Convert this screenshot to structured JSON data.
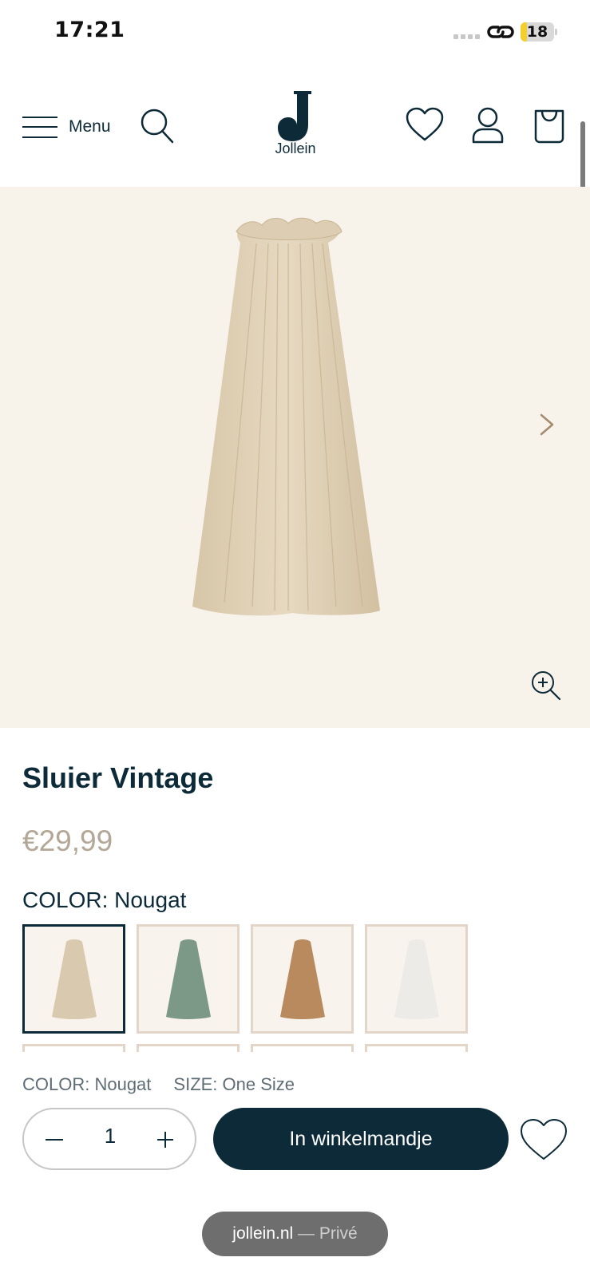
{
  "status_bar": {
    "time": "17:21",
    "battery": "18",
    "battery_level": 0.18
  },
  "header": {
    "menu_label": "Menu",
    "logo_text": "Jollein",
    "icons": [
      "hamburger-icon",
      "search-icon",
      "heart-icon",
      "account-icon",
      "shopping-bag-icon"
    ]
  },
  "gallery": {
    "icons": [
      "chevron-right-icon",
      "zoom-in-icon"
    ]
  },
  "product": {
    "title": "Sluier Vintage",
    "price": "€29,99",
    "color_heading": "COLOR: Nougat",
    "swatches": [
      {
        "name": "Nougat",
        "color": "#d9c9ae",
        "selected": true
      },
      {
        "name": "Green",
        "color": "#7c9887",
        "selected": false
      },
      {
        "name": "Caramel",
        "color": "#b98a5e",
        "selected": false
      },
      {
        "name": "White",
        "color": "#ecebe8",
        "selected": false
      }
    ]
  },
  "sticky_bar": {
    "color_summary": "COLOR: Nougat",
    "size_summary": "SIZE: One Size",
    "quantity": "1",
    "add_to_cart_label": "In winkelmandje"
  },
  "browser": {
    "domain": "jollein.nl",
    "mode": " — Privé"
  },
  "colors": {
    "brand_navy": "#0d2a38",
    "image_bg": "#f7f2ea",
    "price": "#b3a797"
  }
}
